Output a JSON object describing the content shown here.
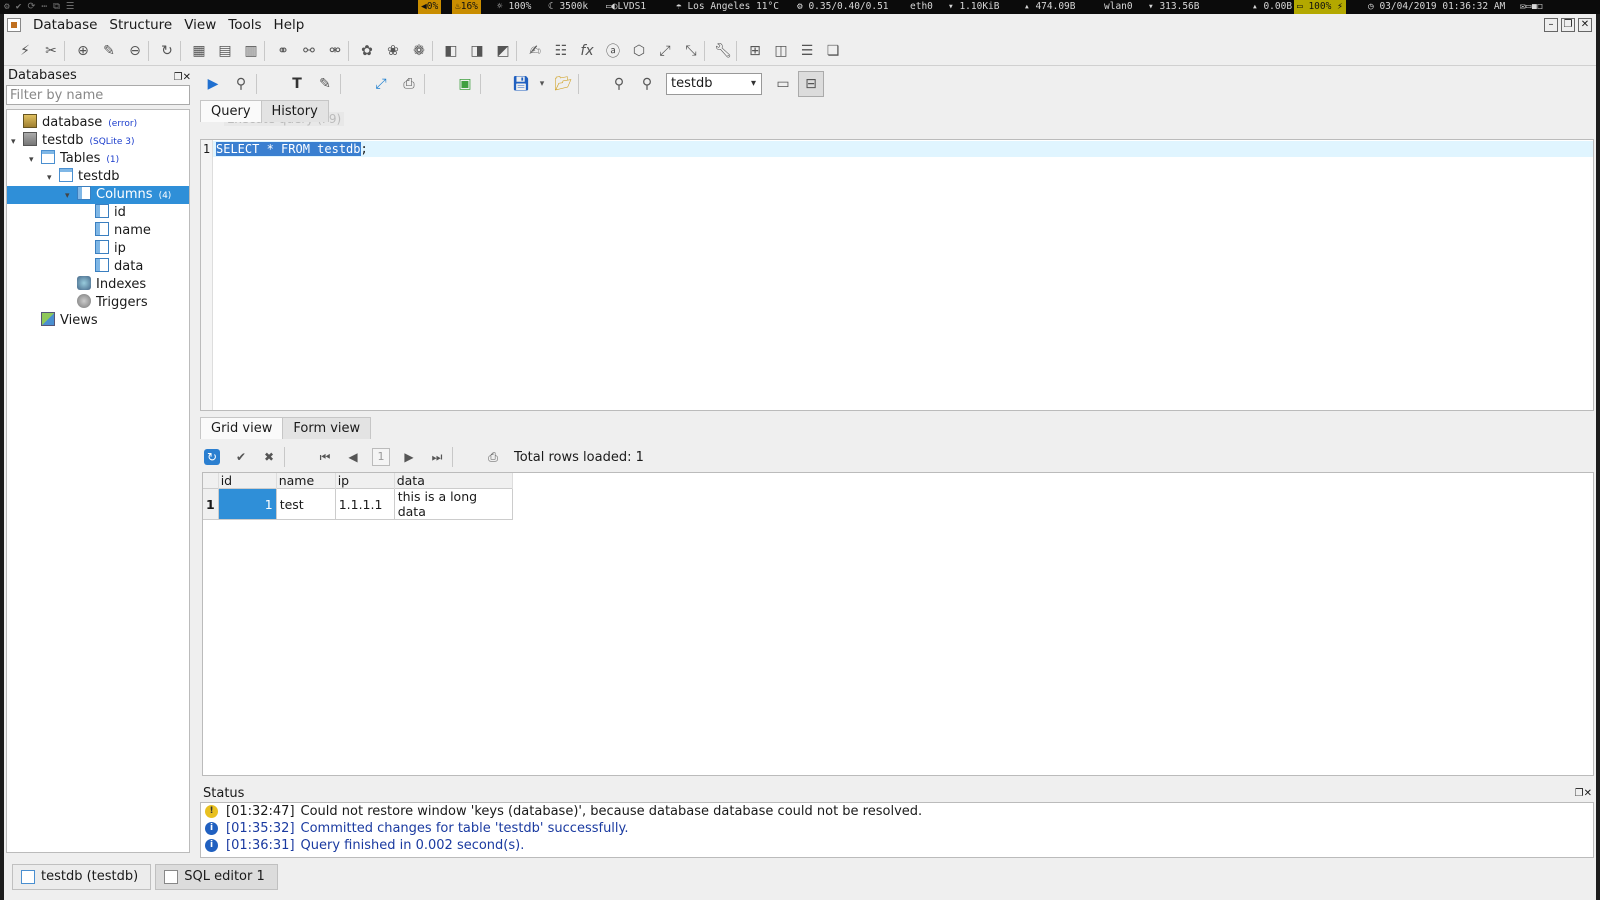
{
  "sysbar": {
    "cpu": "0%",
    "mem": "16%",
    "brightness": "100%",
    "freq": "3500k",
    "display": "LVDS1",
    "weather": "Los Angeles 11°C",
    "load": "0.35/0.40/0.51",
    "eth_iface": "eth0",
    "eth_down": "1.10KiB",
    "eth_up": "474.09B",
    "wlan_iface": "wlan0",
    "wlan_down": "313.56B",
    "wlan_up": "0.00B",
    "battery": "100%",
    "datetime": "03/04/2019 01:36:32 AM"
  },
  "menubar": {
    "items": [
      "Database",
      "Structure",
      "View",
      "Tools",
      "Help"
    ]
  },
  "db_panel": {
    "title": "Databases",
    "filter_placeholder": "Filter by name",
    "tree": {
      "database": {
        "label": "database",
        "tag": "(error)"
      },
      "testdb": {
        "label": "testdb",
        "tag": "(SQLite 3)"
      },
      "tables": {
        "label": "Tables",
        "tag": "(1)"
      },
      "table_testdb": {
        "label": "testdb"
      },
      "columns": {
        "label": "Columns",
        "tag": "(4)"
      },
      "column_items": [
        "id",
        "name",
        "ip",
        "data"
      ],
      "indexes": {
        "label": "Indexes"
      },
      "triggers": {
        "label": "Triggers"
      },
      "views": {
        "label": "Views"
      }
    }
  },
  "editor": {
    "db_select": "testdb",
    "tooltip": "Execute query (F9)",
    "tabs": [
      "Query",
      "History"
    ],
    "line_number": "1",
    "query_selected": "SELECT * FROM testdb",
    "query_rest": ";"
  },
  "results": {
    "tabs": [
      "Grid view",
      "Form view"
    ],
    "page": "1",
    "total_rows": "Total rows loaded: 1",
    "columns": [
      "id",
      "name",
      "ip",
      "data"
    ],
    "rows": [
      {
        "num": "1",
        "id": "1",
        "name": "test",
        "ip": "1.1.1.1",
        "data": "this is a long data"
      }
    ]
  },
  "status": {
    "title": "Status",
    "messages": [
      {
        "type": "warning",
        "time": "[01:32:47]",
        "text": "Could not restore window 'keys (database)', because database database could not be resolved."
      },
      {
        "type": "info",
        "time": "[01:35:32]",
        "text": "Committed changes for table 'testdb' successfully."
      },
      {
        "type": "info",
        "time": "[01:36:31]",
        "text": "Query finished in 0.002 second(s)."
      }
    ]
  },
  "window_tabs": [
    "testdb (testdb)",
    "SQL editor 1"
  ]
}
